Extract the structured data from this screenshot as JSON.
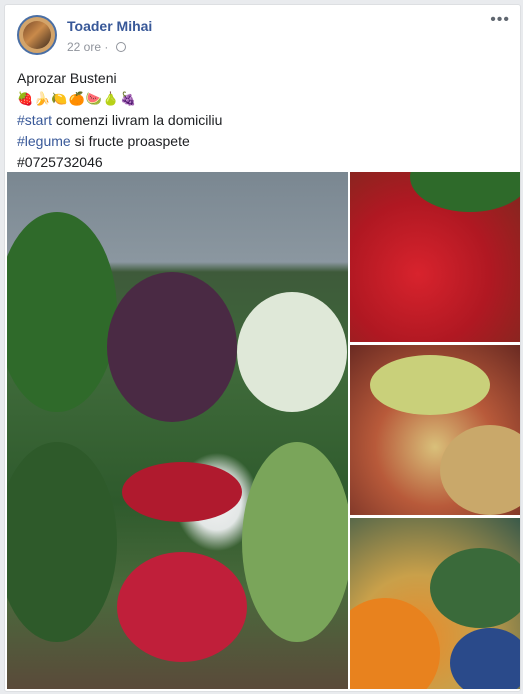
{
  "post": {
    "author": "Toader Mihai",
    "time": "22 ore",
    "separator": "·",
    "more_label": "•••",
    "lines": {
      "title": "Aprozar Busteni",
      "emoji": "🍓🍌🍋🍊🍉🍐🍇",
      "tag1": "#start",
      "line2_rest": " comenzi livram la domiciliu",
      "tag2": "#legume",
      "line3_rest": " si fructe proaspete",
      "phone": "#0725732046"
    }
  },
  "icons": {
    "avatar": "profile-photo",
    "globe": "globe-icon",
    "more": "more-options-icon"
  },
  "colors": {
    "name": "#385898",
    "hashtag": "#385898",
    "meta": "#90949c",
    "text": "#1c1e21"
  }
}
